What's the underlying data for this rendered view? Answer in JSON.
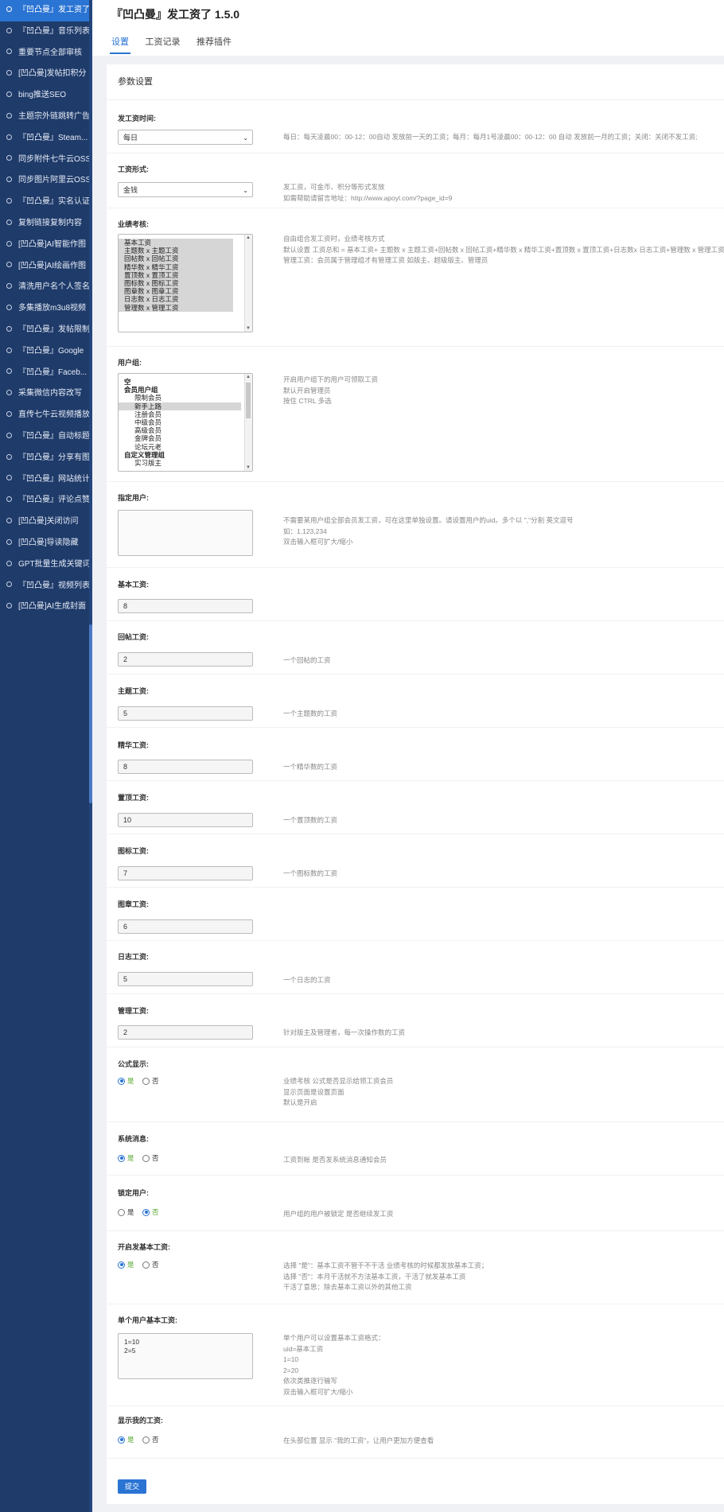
{
  "sidebar": {
    "items": [
      {
        "label": "『凹凸曼』发工资了",
        "active": true
      },
      {
        "label": "『凹凸曼』音乐列表"
      },
      {
        "label": "重要节点全部审核"
      },
      {
        "label": "[凹凸曼]发帖扣积分"
      },
      {
        "label": "bing推送SEO"
      },
      {
        "label": "主题宗外链跳转广告"
      },
      {
        "label": "『凹凸曼』Steam..."
      },
      {
        "label": "同步附件七牛云OSS"
      },
      {
        "label": "同步图片阿里云OSS"
      },
      {
        "label": "『凹凸曼』实名认证"
      },
      {
        "label": "复制链接复制内容"
      },
      {
        "label": "[凹凸曼]AI智能作图"
      },
      {
        "label": "[凹凸曼]AI绘画作图"
      },
      {
        "label": "清洗用户名个人签名"
      },
      {
        "label": "多集播放m3u8视频"
      },
      {
        "label": "『凹凸曼』发帖限制"
      },
      {
        "label": "『凹凸曼』Google"
      },
      {
        "label": "『凹凸曼』Faceb..."
      },
      {
        "label": "采集微信内容改写"
      },
      {
        "label": "直传七牛云视频播放"
      },
      {
        "label": "『凹凸曼』自动标题"
      },
      {
        "label": "『凹凸曼』分享有图"
      },
      {
        "label": "『凹凸曼』网站统计"
      },
      {
        "label": "『凹凸曼』评论点赞"
      },
      {
        "label": "[凹凸曼]关闭访问"
      },
      {
        "label": "[凹凸曼]导读隐藏"
      },
      {
        "label": "GPT批量生成关键词"
      },
      {
        "label": "『凹凸曼』视频列表"
      },
      {
        "label": "[凹凸曼]AI生成封面"
      }
    ]
  },
  "header": {
    "title": "『凹凸曼』发工资了 1.5.0",
    "tabs": [
      {
        "label": "设置",
        "active": true
      },
      {
        "label": "工资记录"
      },
      {
        "label": "推荐插件"
      }
    ]
  },
  "panel": {
    "title": "参数设置",
    "submit_label": "提交"
  },
  "form": {
    "pay_time": {
      "label": "发工资时间:",
      "value": "每日",
      "desc": [
        "每日：每天凌晨00：00-12：00自动 发放前一天的工资；每月：每月1号凌晨00：00-12：00 自动 发放前一月的工资；关闭：关闭不发工资;"
      ]
    },
    "pay_form": {
      "label": "工资形式:",
      "value": "金钱",
      "desc": [
        "发工资，可金币、积分等形式发放",
        "如需帮助请留言地址：http://www.apoyl.com/?page_id=9"
      ]
    },
    "performance": {
      "label": "业绩考核:",
      "options": [
        "基本工资",
        "主题数 x 主题工资",
        "回帖数 x 回帖工资",
        "精华数 x 精华工资",
        "置顶数 x 置顶工资",
        "图标数 x 图标工资",
        "图章数 x 图章工资",
        "日志数 x 日志工资",
        "管理数 x 管理工资"
      ],
      "desc": [
        "自由组合发工资时，业绩考核方式",
        "默认设置 工资总和 = 基本工资+ 主题数 x 主题工资+回帖数 x 回帖工资+精华数 x 精华工资+置顶数 x 置顶工资+日志数x 日志工资+管理数 x 管理工资",
        "管理工资：会员属于管理组才有管理工资 如版主、超级版主、管理员"
      ]
    },
    "user_group": {
      "label": "用户组:",
      "options": [
        {
          "text": "空",
          "ind": false
        },
        {
          "text": "会员用户组",
          "ind": false
        },
        {
          "text": "限制会员",
          "ind": true
        },
        {
          "text": "新手上路",
          "ind": true,
          "sel": true
        },
        {
          "text": "注册会员",
          "ind": true
        },
        {
          "text": "中级会员",
          "ind": true
        },
        {
          "text": "高级会员",
          "ind": true
        },
        {
          "text": "金牌会员",
          "ind": true
        },
        {
          "text": "论坛元老",
          "ind": true
        },
        {
          "text": "自定义管理组",
          "ind": false
        },
        {
          "text": "实习版主",
          "ind": true
        }
      ],
      "desc": [
        "开启用户组下的用户可领取工资",
        "默认开启管理员",
        "按住 CTRL 多选"
      ]
    },
    "specified_user": {
      "label": "指定用户:",
      "value": "",
      "desc": [
        "不需要某用户组全部会员发工资，可在这里单独设置。请设置用户的uid。多个以 \",\"分割 英文逗号",
        "如：1,123,234",
        "双击输入框可扩大/缩小"
      ]
    },
    "base_salary": {
      "label": "基本工资:",
      "value": "8",
      "desc": [
        ""
      ]
    },
    "reply_salary": {
      "label": "回帖工资:",
      "value": "2",
      "desc": [
        "一个回帖的工资"
      ]
    },
    "topic_salary": {
      "label": "主题工资:",
      "value": "5",
      "desc": [
        "一个主题数的工资"
      ]
    },
    "digest_salary": {
      "label": "精华工资:",
      "value": "8",
      "desc": [
        "一个精华数的工资"
      ]
    },
    "top_salary": {
      "label": "置顶工资:",
      "value": "10",
      "desc": [
        "一个置顶数的工资"
      ]
    },
    "icon_salary": {
      "label": "图标工资:",
      "value": "7",
      "desc": [
        "一个图标数的工资"
      ]
    },
    "stamp_salary": {
      "label": "图章工资:",
      "value": "6",
      "desc": [
        ""
      ]
    },
    "log_salary": {
      "label": "日志工资:",
      "value": "5",
      "desc": [
        "一个日志的工资"
      ]
    },
    "manage_salary": {
      "label": "管理工资:",
      "value": "2",
      "desc": [
        "针对版主及管理者，每一次操作数的工资"
      ]
    },
    "formula_show": {
      "label": "公式显示:",
      "yes": "是",
      "no": "否",
      "selected": "yes",
      "desc": [
        "业绩考核 公式是否显示给领工资会员",
        "显示页面是设置页面",
        "默认是开启"
      ]
    },
    "system_msg": {
      "label": "系统消息:",
      "yes": "是",
      "no": "否",
      "selected": "yes",
      "desc": [
        "工资到帐 是否发系统消息通知会员"
      ]
    },
    "lock_user": {
      "label": "锁定用户:",
      "yes": "是",
      "no": "否",
      "selected": "no",
      "desc": [
        "用户组的用户被锁定 是否继续发工资"
      ]
    },
    "base_pay_on": {
      "label": "开启发基本工资:",
      "yes": "是",
      "no": "否",
      "selected": "yes",
      "desc": [
        "选择 \"是\"：基本工资不管干不干活 业绩考核的时候都发放基本工资；",
        "选择 \"否\"：本月干活就不方法基本工资，干活了就发基本工资",
        "干活了意思：除去基本工资以外的其他工资"
      ]
    },
    "single_user_base": {
      "label": "单个用户基本工资:",
      "lines": [
        "1=10",
        "2=5"
      ],
      "desc": [
        "单个用户可以设置基本工资格式：",
        "uid=基本工资",
        "1=10",
        "2=20",
        "依次类推逐行输写",
        "双击输入框可扩大/缩小"
      ]
    },
    "show_my_salary": {
      "label": "显示我的工资:",
      "yes": "是",
      "no": "否",
      "selected": "yes",
      "desc": [
        "在头部位置 显示 \"我的工资\"，让用户更加方便查看"
      ]
    }
  }
}
